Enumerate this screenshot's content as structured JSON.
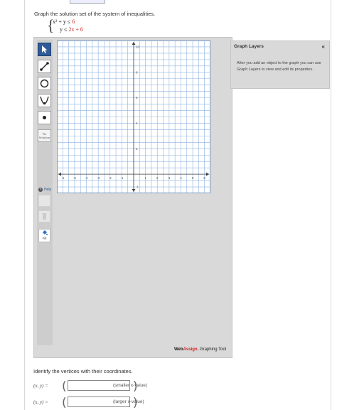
{
  "prompt": "Graph the solution set of the system of inequalities.",
  "system": {
    "line1_lhs": "x² + y",
    "line1_op": "≤",
    "line1_rhs": "6",
    "line2_lhs": "y",
    "line2_op": "≤",
    "line2_rhs": "2x + 6"
  },
  "toolbar": {
    "tools": [
      "pointer-tool",
      "line-tool",
      "circle-tool",
      "parabola-tool",
      "point-tool"
    ],
    "no_solution_line1": "No",
    "no_solution_line2": "Solution",
    "help_label": "Help",
    "fill_label": "Fill"
  },
  "graph": {
    "x_ticks": [
      "-6",
      "-5",
      "-4",
      "-3",
      "-2",
      "-1",
      "1",
      "2",
      "3",
      "4",
      "5",
      "6"
    ],
    "y_ticks": [
      "10",
      "8",
      "6",
      "4",
      "2",
      "-1"
    ],
    "x_min": -6.5,
    "x_max": 6.5,
    "y_min": -1.5,
    "y_max": 10.5,
    "accent": "#2e6ec9"
  },
  "brand": {
    "web": "Web",
    "assign": "Assign",
    "dot": ".",
    "tool_name": "Graphing Tool"
  },
  "layers": {
    "title": "Graph Layers",
    "collapse": "«",
    "body": "After you add an object to the graph you can use Graph Layers to view and edit its properties."
  },
  "answers": {
    "instruction": "Identify the vertices with their coordinates.",
    "rows": [
      {
        "label": "(x, y) =",
        "note": "(smaller x-value)"
      },
      {
        "label": "(x, y) =",
        "note": "(larger x-value)"
      }
    ]
  }
}
